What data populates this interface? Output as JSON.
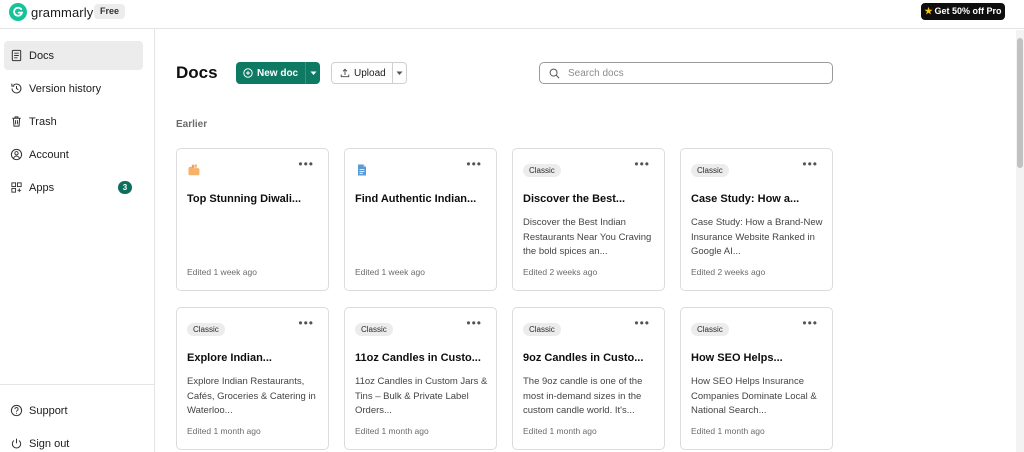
{
  "app": {
    "logo_text": "grammarly",
    "plan": "Free",
    "upgrade_label": "Get 50% off Pro",
    "brand_color": "#15c39a",
    "accent_color": "#0e7a63"
  },
  "sidebar": {
    "items": [
      {
        "label": "Docs",
        "icon": "document-icon",
        "active": true
      },
      {
        "label": "Version history",
        "icon": "history-icon"
      },
      {
        "label": "Trash",
        "icon": "trash-icon"
      },
      {
        "label": "Account",
        "icon": "account-icon"
      },
      {
        "label": "Apps",
        "icon": "apps-icon",
        "badge": "3"
      }
    ],
    "footer": [
      {
        "label": "Support",
        "icon": "help-icon"
      },
      {
        "label": "Sign out",
        "icon": "power-icon"
      }
    ]
  },
  "main": {
    "title": "Docs",
    "new_doc_label": "New doc",
    "upload_label": "Upload",
    "search_placeholder": "Search docs",
    "section_label": "Earlier",
    "cards": [
      {
        "icon": "folder-emoji-icon",
        "title": "Top Stunning Diwali...",
        "excerpt": "",
        "edited": "Edited 1 week ago"
      },
      {
        "icon": "doc-file-icon",
        "title": "Find Authentic Indian...",
        "excerpt": "",
        "edited": "Edited 1 week ago"
      },
      {
        "tag": "Classic",
        "title": "Discover the Best...",
        "excerpt": "Discover the Best Indian Restaurants Near You Craving the bold spices an...",
        "edited": "Edited 2 weeks ago"
      },
      {
        "tag": "Classic",
        "title": "Case Study: How a...",
        "excerpt": "Case Study: How a Brand-New Insurance Website Ranked in Google AI...",
        "edited": "Edited 2 weeks ago"
      },
      {
        "tag": "Classic",
        "title": "Explore Indian...",
        "excerpt": "Explore Indian Restaurants, Cafés, Groceries & Catering in Waterloo...",
        "edited": "Edited 1 month ago"
      },
      {
        "tag": "Classic",
        "title": "11oz Candles in Custo...",
        "excerpt": "11oz Candles in Custom Jars & Tins – Bulk & Private Label Orders...",
        "edited": "Edited 1 month ago"
      },
      {
        "tag": "Classic",
        "title": "9oz Candles in Custo...",
        "excerpt": "The 9oz candle is one of the most in-demand sizes in the custom candle world. It's...",
        "edited": "Edited 1 month ago"
      },
      {
        "tag": "Classic",
        "title": "How SEO Helps...",
        "excerpt": "How SEO Helps Insurance Companies Dominate Local & National Search...",
        "edited": "Edited 1 month ago"
      }
    ]
  }
}
